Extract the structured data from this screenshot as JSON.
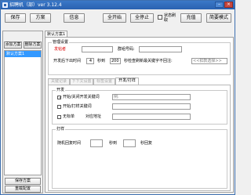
{
  "window": {
    "title_prefix": "招聘机（部）ver 3.12.4"
  },
  "toolbar": {
    "buttons": [
      {
        "id": "save",
        "label": "保存"
      },
      {
        "id": "qa",
        "label": "方案"
      },
      {
        "id": "info",
        "label": "信息"
      },
      {
        "id": "start_all",
        "label": "全开始"
      },
      {
        "id": "stop_all",
        "label": "全停止"
      },
      {
        "id": "refresh",
        "label": "充值"
      },
      {
        "id": "help",
        "label": "简要模式"
      }
    ],
    "checkbox_label": "状态刷取"
  },
  "left_panel": {
    "add_label": "添加方案",
    "delete_label": "删除方案",
    "schemes": [
      "默认方案1"
    ],
    "save_label": "保存方案",
    "reset_label": "重载配置"
  },
  "main": {
    "tab_label": "默认方案1",
    "settings": {
      "title": "管理设置",
      "account_label": "发帖者",
      "group_label": "群组号码:",
      "interval_label": "开发后下出时间",
      "interval_value": "4",
      "interval_unit": "秒到",
      "interval_max": "200",
      "rule_text": "秒检查刷新最关键字不回注:",
      "rule_placeholder": "<<扣款选择>>"
    },
    "subtabs": [
      "关键记录",
      "下下文设置",
      "标签设置",
      "开发/打样"
    ],
    "active_subtab": 3,
    "open": {
      "title": "开发",
      "items": [
        {
          "label": "开始/关闭开发关键词",
          "checked": true,
          "input_placeholder": "例:"
        },
        {
          "label": "开始/打样关键词",
          "checked": false,
          "input_placeholder": ""
        },
        {
          "label": "无标单",
          "checked": false,
          "extra": "对应地址"
        }
      ]
    },
    "print": {
      "title": "打样",
      "delay_label": "随机回复时间",
      "unit1": "秒到",
      "unit2": "秒回复"
    }
  }
}
